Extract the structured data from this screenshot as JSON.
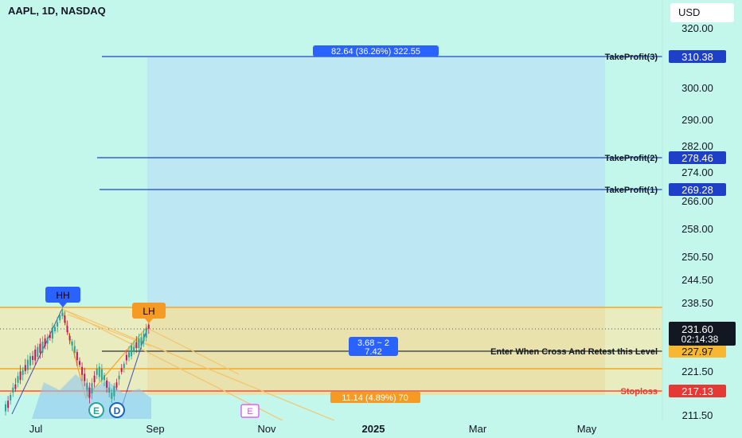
{
  "header": {
    "symbol_line": "AAPL, 1D, NASDAQ",
    "currency": "USD"
  },
  "chart_data": {
    "type": "line",
    "title": "AAPL, 1D, NASDAQ",
    "y_ticks": [
      320.0,
      300.0,
      290.0,
      282.0,
      274.0,
      266.0,
      258.0,
      250.5,
      244.5,
      238.5,
      221.5,
      211.5
    ],
    "x_ticks": [
      {
        "label": "Jul",
        "bold": false
      },
      {
        "label": "Sep",
        "bold": false
      },
      {
        "label": "Nov",
        "bold": false
      },
      {
        "label": "2025",
        "bold": true
      },
      {
        "label": "Mar",
        "bold": false
      },
      {
        "label": "May",
        "bold": false
      }
    ],
    "levels": [
      {
        "name": "TakeProfit(3)",
        "value": 310.38,
        "tag": "310.38",
        "color": "#1a46c4"
      },
      {
        "name": "TakeProfit(2)",
        "value": 278.46,
        "tag": "278.46",
        "color": "#1a46c4"
      },
      {
        "name": "TakeProfit(1)",
        "value": 269.28,
        "tag": "269.28",
        "color": "#1a46c4"
      },
      {
        "name": "Enter When Cross And Retest this Level",
        "value": 227.97,
        "tag": "227.97",
        "color": "#f5a623"
      },
      {
        "name": "Stoploss",
        "value": 217.13,
        "tag": "217.13",
        "color": "#e53935"
      }
    ],
    "current_price": {
      "value": "231.60",
      "countdown": "02:14:38"
    },
    "measure_labels": {
      "target": "82.64 (36.26%) 322.55",
      "risk": "11.14 (4.89%) 70",
      "ratio_line1": "3.68 ~ 2",
      "ratio_line2": "7.42"
    },
    "pivots": [
      {
        "label": "HH",
        "color": "#2962ff"
      },
      {
        "label": "LH",
        "color": "#f59a23"
      }
    ],
    "event_markers": [
      "E",
      "D",
      "E"
    ],
    "colors": {
      "background": "#c4f7ec",
      "target_zone": "#bde7f3",
      "risk_zone": "#f2e6b0",
      "up_candle": "#26a69a",
      "down_candle": "#c2185b",
      "take_profit": "#1a46c4",
      "entry": "#f5a623",
      "stop": "#e53935"
    }
  }
}
